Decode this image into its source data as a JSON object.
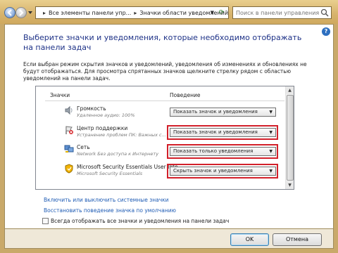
{
  "window": {
    "address": {
      "segments": [
        "Все элементы панели упр...",
        "Значки области уведомлений"
      ],
      "separator": "▸"
    },
    "search": {
      "placeholder": "Поиск в панели управления"
    },
    "help": "?"
  },
  "main": {
    "title": "Выберите значки и уведомления, которые необходимо отображать на панели задач",
    "description": "Если выбран режим скрытия значков и уведомлений, уведомления об изменениях и обновлениях не будут отображаться. Для просмотра спрятанных значков щелкните стрелку рядом с областью уведомлений на панели задач.",
    "columns": {
      "icons": "Значки",
      "behavior": "Поведение"
    },
    "rows": [
      {
        "name": "Громкость",
        "subtitle": "Удаленное аудио: 100%",
        "behavior": "Показать значок и уведомления",
        "icon": "speaker-icon",
        "highlighted": false
      },
      {
        "name": "Центр поддержки",
        "subtitle": "Устранение проблем ПК: Важных с...",
        "behavior": "Показать значок и уведомления",
        "icon": "action-center-flag-icon",
        "highlighted": true
      },
      {
        "name": "Сеть",
        "subtitle": "Network Без доступа к Интернету",
        "behavior": "Показать только уведомления",
        "icon": "network-icon",
        "highlighted": true
      },
      {
        "name": "Microsoft Security Essentials User Inte...",
        "subtitle": "Microsoft Security Essentials",
        "behavior": "Скрыть значок и уведомления",
        "icon": "security-essentials-icon",
        "highlighted": true
      }
    ],
    "links": {
      "system_icons": "Включить или выключить системные значки",
      "restore_defaults": "Восстановить поведение значка по умолчанию"
    },
    "always_show": {
      "label": "Всегда отображать все значки и уведомления на панели задач",
      "checked": false
    }
  },
  "buttons": {
    "ok": "OK",
    "cancel": "Отмена"
  },
  "colors": {
    "frame": "#d7b36c",
    "title": "#1e3287",
    "link": "#1e5bb4",
    "highlight": "#d2202a"
  }
}
